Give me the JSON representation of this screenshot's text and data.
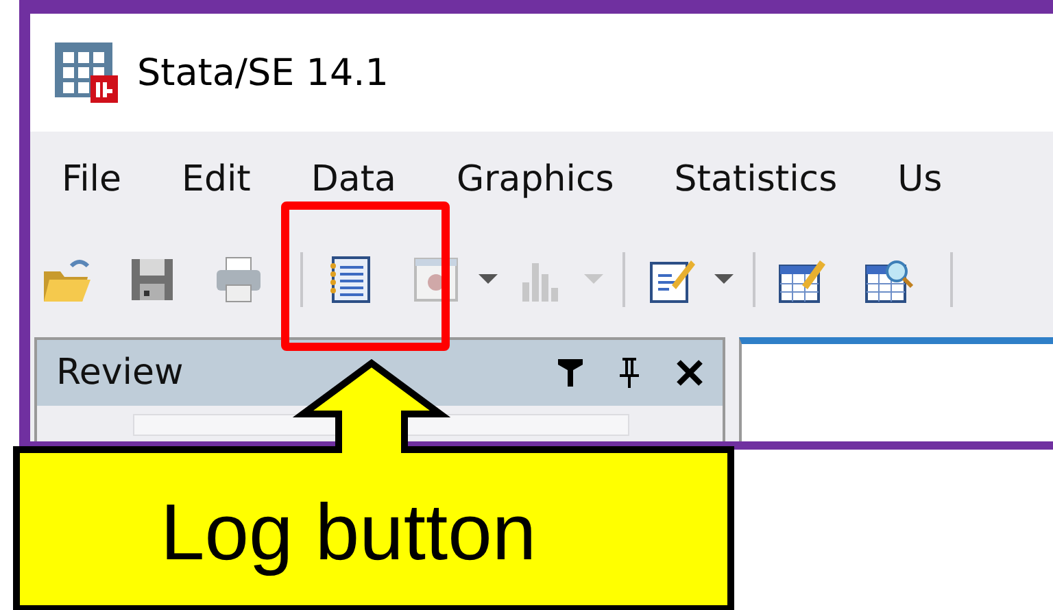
{
  "window": {
    "title": "Stata/SE 14.1"
  },
  "menu": [
    "File",
    "Edit",
    "Data",
    "Graphics",
    "Statistics",
    "Us"
  ],
  "toolbar": [
    {
      "kind": "open",
      "dropdown": false,
      "disabled": false
    },
    {
      "kind": "save",
      "dropdown": false,
      "disabled": false
    },
    {
      "kind": "print",
      "dropdown": false,
      "disabled": false
    },
    {
      "kind": "separator"
    },
    {
      "kind": "log",
      "dropdown": false,
      "disabled": false
    },
    {
      "kind": "viewer",
      "dropdown": true,
      "disabled": false
    },
    {
      "kind": "graph",
      "dropdown": true,
      "disabled": true
    },
    {
      "kind": "separator"
    },
    {
      "kind": "editor",
      "dropdown": true,
      "disabled": false
    },
    {
      "kind": "separator"
    },
    {
      "kind": "data-edit",
      "dropdown": false,
      "disabled": false
    },
    {
      "kind": "data-browse",
      "dropdown": false,
      "disabled": false
    },
    {
      "kind": "separator"
    }
  ],
  "review": {
    "title": "Review"
  },
  "annotation": {
    "label": "Log button"
  }
}
